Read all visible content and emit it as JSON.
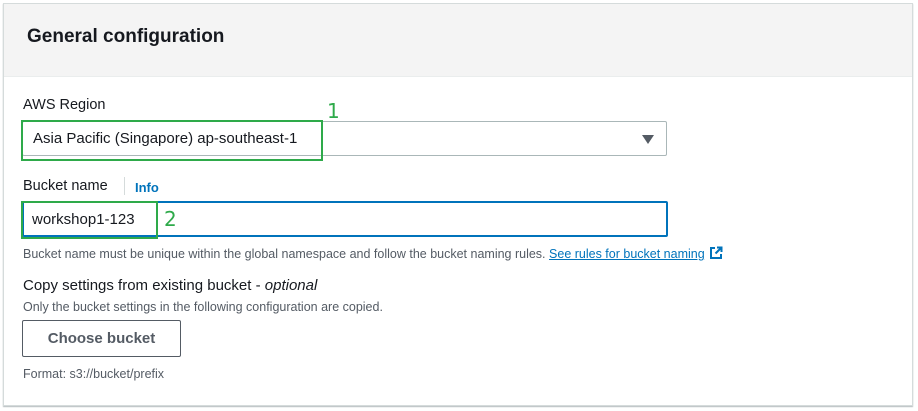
{
  "panel": {
    "title": "General configuration"
  },
  "region": {
    "label": "AWS Region",
    "selected": "Asia Pacific (Singapore) ap-southeast-1",
    "dropdown_icon": "caret-down-icon"
  },
  "bucket_name": {
    "label": "Bucket name",
    "info_link": "Info",
    "value": "workshop1-123",
    "hint_text": "Bucket name must be unique within the global namespace and follow the bucket naming rules.",
    "rules_link": "See rules for bucket naming",
    "rules_link_icon": "external-link-icon"
  },
  "copy_settings": {
    "label": "Copy settings from existing bucket -",
    "optional": "optional",
    "description": "Only the bucket settings in the following configuration are copied.",
    "button_label": "Choose bucket",
    "format_hint": "Format: s3://bucket/prefix"
  },
  "annotations": {
    "region_number": "1",
    "bucket_number": "2",
    "color": "#2eaa4a"
  },
  "colors": {
    "link": "#0073bb",
    "input_focus_border": "#0073bb",
    "header_bg": "#f4f4f4"
  }
}
